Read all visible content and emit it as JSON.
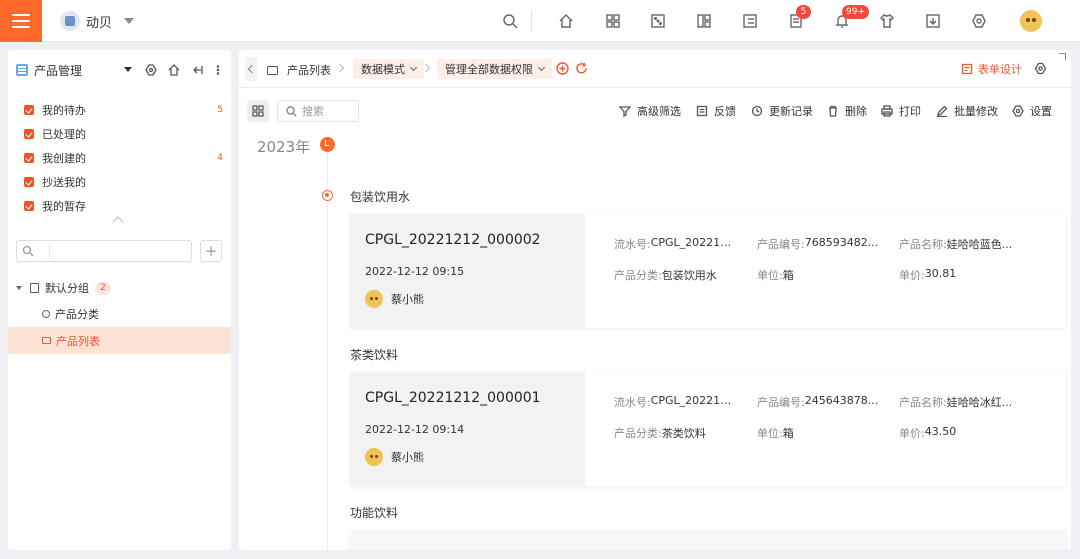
{
  "topbar": {
    "workspace_name": "动贝",
    "badges": {
      "notes": "5",
      "notifications": "99+"
    },
    "accent": "#ff6a2c"
  },
  "sidebar": {
    "app_title": "产品管理",
    "items": [
      {
        "label": "我的待办",
        "count": "5"
      },
      {
        "label": "已处理的",
        "count": ""
      },
      {
        "label": "我创建的",
        "count": "4"
      },
      {
        "label": "抄送我的",
        "count": ""
      },
      {
        "label": "我的暂存",
        "count": ""
      }
    ],
    "search_placeholder": "",
    "tree": {
      "group_label": "默认分组",
      "group_count": "2",
      "nodes": [
        {
          "label": "产品分类"
        },
        {
          "label": "产品列表"
        }
      ]
    }
  },
  "tabbar": {
    "breadcrumb_root": "产品列表",
    "mode_label": "数据模式",
    "permission_label": "管理全部数据权限",
    "form_design_label": "表单设计"
  },
  "toolbar": {
    "search_placeholder": "搜索",
    "actions": {
      "advanced_filter": "高级筛选",
      "feedback": "反馈",
      "update_log": "更新记录",
      "delete": "删除",
      "print": "打印",
      "batch_edit": "批量修改",
      "settings": "设置"
    }
  },
  "timeline": {
    "year": "2023年",
    "groups": [
      {
        "title": "包装饮用水",
        "record": {
          "id": "CPGL_20221212_000002",
          "time": "2022-12-12 09:15",
          "user": "蔡小熊",
          "fields": [
            {
              "label": "流水号:",
              "value": "CPGL_20221212_000002"
            },
            {
              "label": "产品编号:",
              "value": "768593482..."
            },
            {
              "label": "产品名称:",
              "value": "娃哈哈蓝色..."
            },
            {
              "label": "产品分类:",
              "value": "包装饮用水"
            },
            {
              "label": "单位:",
              "value": "箱"
            },
            {
              "label": "单价:",
              "value": "30.81"
            }
          ]
        }
      },
      {
        "title": "茶类饮料",
        "record": {
          "id": "CPGL_20221212_000001",
          "time": "2022-12-12 09:14",
          "user": "蔡小熊",
          "fields": [
            {
              "label": "流水号:",
              "value": "CPGL_20221212_000001"
            },
            {
              "label": "产品编号:",
              "value": "245643878..."
            },
            {
              "label": "产品名称:",
              "value": "娃哈哈冰红..."
            },
            {
              "label": "产品分类:",
              "value": "茶类饮料"
            },
            {
              "label": "单位:",
              "value": "箱"
            },
            {
              "label": "单价:",
              "value": "43.50"
            }
          ]
        }
      },
      {
        "title": "功能饮料"
      }
    ]
  }
}
